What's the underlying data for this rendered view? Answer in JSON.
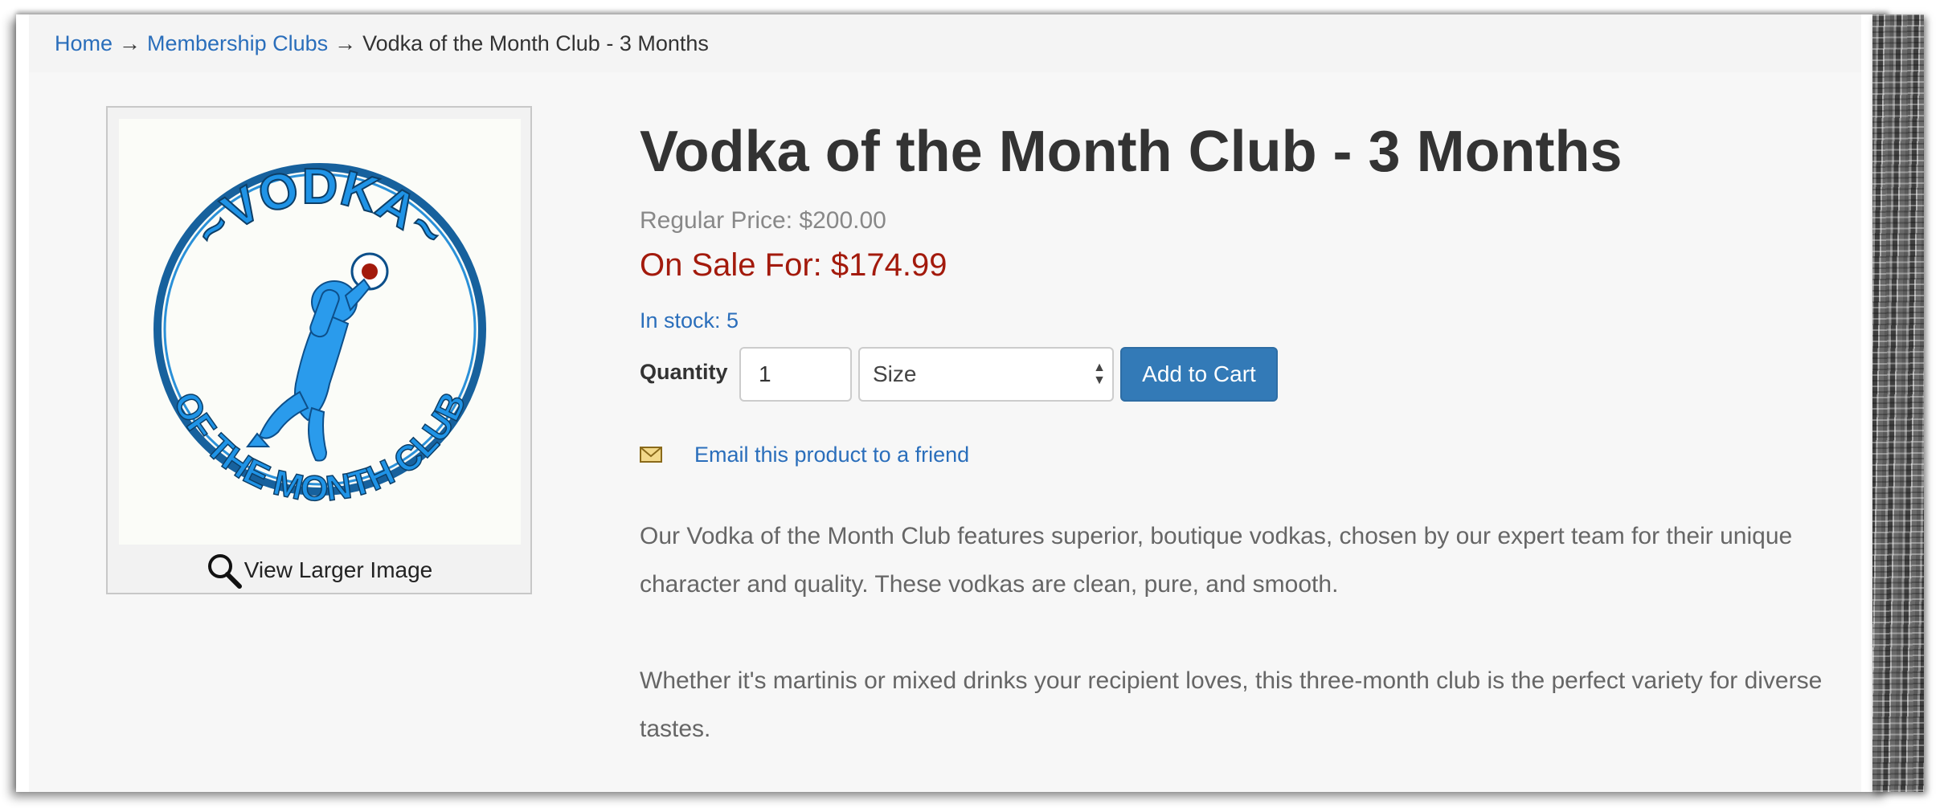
{
  "breadcrumb": {
    "home": "Home",
    "separator": "→",
    "category": "Membership Clubs",
    "current": "Vodka of the Month Club - 3 Months"
  },
  "product": {
    "title": "Vodka of the Month Club - 3 Months",
    "regular_price": "Regular Price: $200.00",
    "sale_price": "On Sale For: $174.99",
    "stock": "In stock: 5",
    "quantity_label": "Quantity",
    "quantity_value": "1",
    "size_label": "Size",
    "add_to_cart": "Add to Cart",
    "email_link": "Email this product to a friend",
    "view_larger": "View Larger Image",
    "description": [
      "Our Vodka of the Month Club features superior, boutique vodkas, chosen by our expert team for their unique character and quality. These vodkas are clean, pure, and smooth.",
      "Whether it's martinis or mixed drinks your recipient loves, this three-month club is the perfect variety for diverse tastes."
    ]
  },
  "logo": {
    "top_text": "~VODKA~",
    "bottom_text": "OF THE MONTH CLUB"
  },
  "colors": {
    "link": "#2a6ebb",
    "sale_price": "#a31a0c",
    "button": "#337ab7",
    "logo_blue": "#1f93e6",
    "logo_ring": "#17619d"
  }
}
